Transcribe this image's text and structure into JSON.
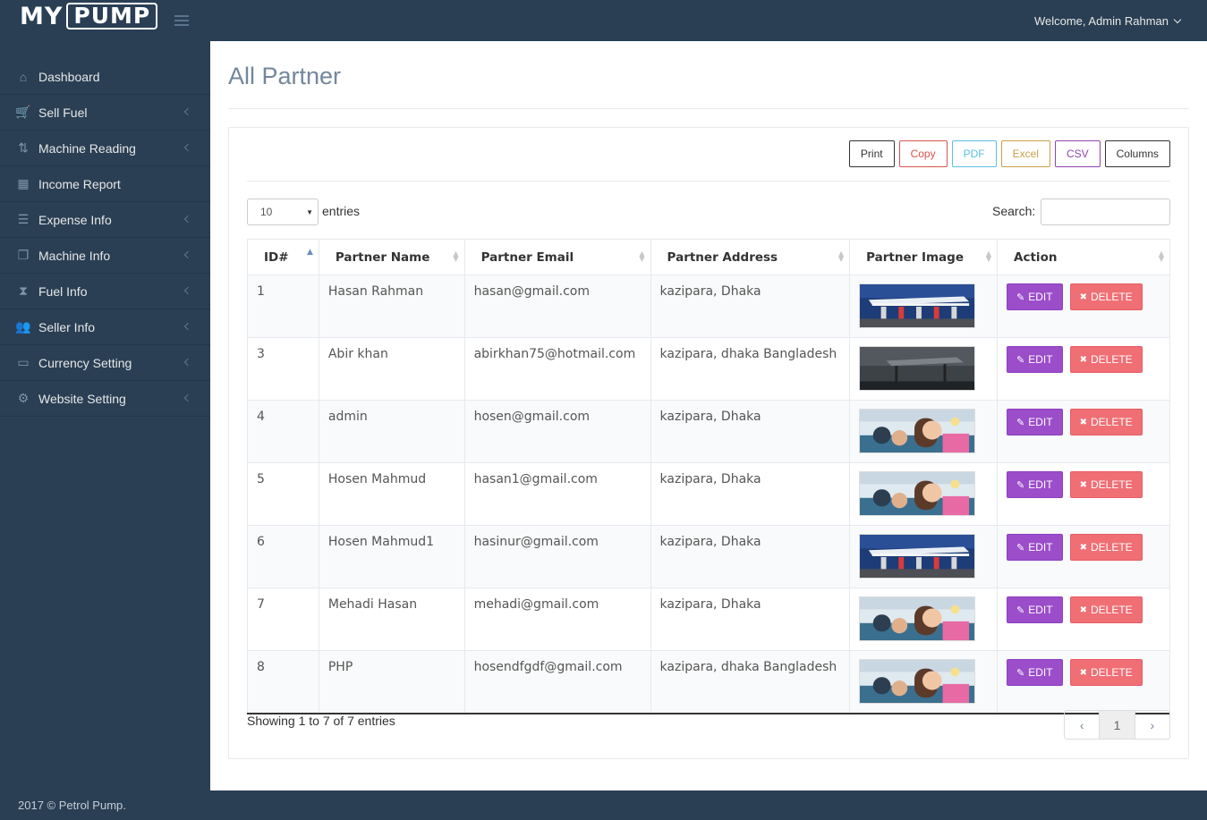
{
  "header": {
    "logo_my": "MY",
    "logo_pump": "PUMP",
    "welcome": "Welcome, Admin Rahman"
  },
  "sidebar": {
    "items": [
      {
        "label": "Dashboard",
        "icon": "home-icon",
        "expandable": false
      },
      {
        "label": "Sell Fuel",
        "icon": "cart-icon",
        "expandable": true
      },
      {
        "label": "Machine Reading",
        "icon": "sort-amount-icon",
        "expandable": true
      },
      {
        "label": "Income Report",
        "icon": "calendar-icon",
        "expandable": false
      },
      {
        "label": "Expense Info",
        "icon": "server-icon",
        "expandable": true
      },
      {
        "label": "Machine Info",
        "icon": "files-icon",
        "expandable": true
      },
      {
        "label": "Fuel Info",
        "icon": "hourglass-icon",
        "expandable": true
      },
      {
        "label": "Seller Info",
        "icon": "users-icon",
        "expandable": true
      },
      {
        "label": "Currency Setting",
        "icon": "credit-card-icon",
        "expandable": true
      },
      {
        "label": "Website Setting",
        "icon": "gears-icon",
        "expandable": true
      }
    ]
  },
  "page": {
    "title": "All Partner"
  },
  "toolbar": {
    "buttons": [
      {
        "label": "Print",
        "color": "#333333"
      },
      {
        "label": "Copy",
        "color": "#d9534f"
      },
      {
        "label": "PDF",
        "color": "#5bc0de"
      },
      {
        "label": "Excel",
        "color": "#c9a04a"
      },
      {
        "label": "CSV",
        "color": "#8e44ad"
      },
      {
        "label": "Columns",
        "color": "#333333"
      }
    ]
  },
  "controls": {
    "length_value": "10",
    "length_label": "entries",
    "search_label": "Search:",
    "search_value": ""
  },
  "table": {
    "columns": [
      "ID#",
      "Partner Name",
      "Partner Email",
      "Partner Address",
      "Partner Image",
      "Action"
    ],
    "rows": [
      {
        "id": "1",
        "name": "Hasan Rahman",
        "email": "hasan@gmail.com",
        "address": "kazipara, Dhaka",
        "image": "station-night"
      },
      {
        "id": "3",
        "name": "Abir khan",
        "email": "abirkhan75@hotmail.com",
        "address": "kazipara, dhaka Bangladesh",
        "image": "station-dark"
      },
      {
        "id": "4",
        "name": "admin",
        "email": "hosen@gmail.com",
        "address": "kazipara, Dhaka",
        "image": "kids-classroom"
      },
      {
        "id": "5",
        "name": "Hosen Mahmud",
        "email": "hasan1@gmail.com",
        "address": "kazipara, Dhaka",
        "image": "kids-classroom"
      },
      {
        "id": "6",
        "name": "Hosen Mahmud1",
        "email": "hasinur@gmail.com",
        "address": "kazipara, Dhaka",
        "image": "station-night"
      },
      {
        "id": "7",
        "name": "Mehadi Hasan",
        "email": "mehadi@gmail.com",
        "address": "kazipara, Dhaka",
        "image": "kids-classroom"
      },
      {
        "id": "8",
        "name": "PHP",
        "email": "hosendfgdf@gmail.com",
        "address": "kazipara, dhaka Bangladesh",
        "image": "kids-classroom"
      }
    ],
    "edit_label": "EDIT",
    "delete_label": "DELETE"
  },
  "footer_info": {
    "showing": "Showing 1 to 7 of 7 entries",
    "prev": "‹",
    "page": "1",
    "next": "›"
  },
  "footer": {
    "copyright": "2017 © Petrol Pump."
  },
  "colors": {
    "sidebar_bg": "#2a3f54",
    "edit_btn": "#9b4dca",
    "delete_btn": "#ef6f75"
  }
}
